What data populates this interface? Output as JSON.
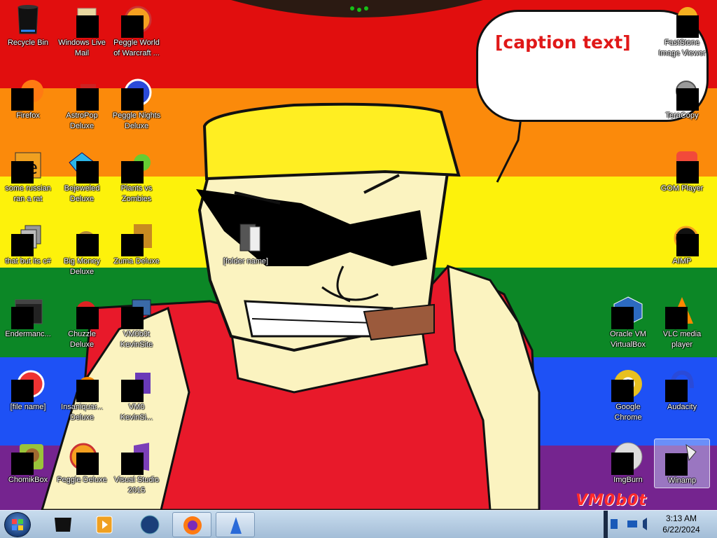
{
  "wallpaper": {
    "stripe_colors": [
      "#e10e0e",
      "#fb8a0b",
      "#fdf20b",
      "#0c8726",
      "#1e51f5",
      "#75248f"
    ],
    "speech_text": "[caption text]",
    "watermark": "VM0b0t"
  },
  "desktop_icons": {
    "recycle_bin": "Recycle Bin",
    "windows_live_mail": "Windows Live\nMail",
    "peggle_world_of_warcraft": "Peggle World\nof Warcraft ...",
    "firefox": "Firefox",
    "astropop_deluxe": "AstroPop\nDeluxe",
    "peggle_nights_deluxe": "Peggle Nights\nDeluxe",
    "some_russian": "some russian\nran a rat",
    "bejeweled_deluxe": "Bejeweled\nDeluxe",
    "plants_vs_zombies": "Plants vs\nZombies",
    "that_but_csharp": "that but its c#",
    "big_money_deluxe": "Big Money\nDeluxe",
    "zuma_deluxe": "Zuma Deluxe",
    "folder_center": "[folder name]",
    "endermanch": "Endermanc...",
    "chuzzle_deluxe": "Chuzzle\nDeluxe",
    "vm0b0t_kevinsite": "VM0b0t\nKevinSite",
    "none_of_you": "[file name]",
    "insaniquarium_deluxe": "Insaniquar...\nDeluxe",
    "vm0_kevinsi": "VM0\nKevinSi...",
    "chomikbox": "ChomikBox",
    "peggle_deluxe": "Peggle Deluxe",
    "visual_studio_2015": "Visual Studio\n2015",
    "faststone": "FastStone\nImage Viewer",
    "teracopy": "TeraCopy",
    "gom_player": "GOM Player",
    "aimp": "AIMP",
    "oracle_vm_virtualbox": "Oracle VM\nVirtualBox",
    "vlc_media_player": "VLC media\nplayer",
    "google_chrome": "Google\nChrome",
    "audacity": "Audacity",
    "imgburn": "ImgBurn",
    "winamp": "Winamp"
  },
  "taskbar": {
    "pinned": [
      "terminal-icon",
      "media-player-icon",
      "globe-icon",
      "firefox-icon",
      "app-icon"
    ],
    "clock_time": "3:13 AM",
    "clock_date": "6/22/2024"
  }
}
